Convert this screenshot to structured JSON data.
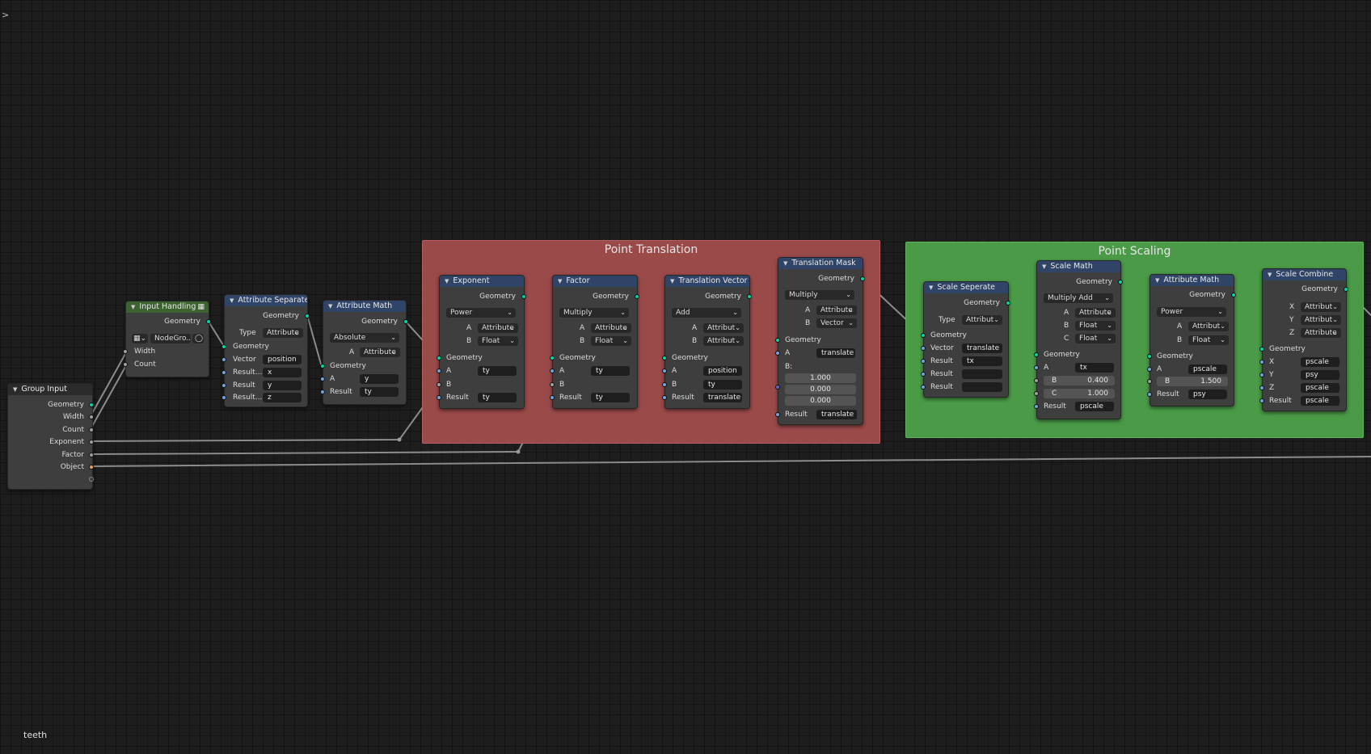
{
  "editor": {
    "tree_name": "teeth",
    "menu_toggle": ">"
  },
  "colors": {
    "frame_translation": "#9b4a4a",
    "frame_scaling": "#4a9a47",
    "header_attribute": "#2f4467",
    "header_group": "#3d6231",
    "socket_geometry": "#00d6a3",
    "socket_string": "#6fa5dc",
    "socket_float": "#a1a1a1",
    "socket_object": "#ed9e5c"
  },
  "frames": {
    "translation": "Point Translation",
    "scaling": "Point Scaling"
  },
  "group_input": {
    "title": "Group Input",
    "outputs": [
      "Geometry",
      "Width",
      "Count",
      "Exponent",
      "Factor",
      "Object"
    ]
  },
  "input_handling": {
    "title": "Input Handling",
    "group_name": "NodeGro...",
    "outputs": [
      "Geometry"
    ],
    "inputs": [
      "Width",
      "Count"
    ]
  },
  "attr_separate": {
    "title": "Attribute Separate ...",
    "out": "Geometry",
    "type_label": "Type",
    "type_value": "Attribute",
    "geometry": "Geometry",
    "vector_label": "Vector",
    "vector_value": "position",
    "r1_label": "Result...",
    "r1_value": "x",
    "r2_label": "Result",
    "r2_value": "y",
    "r3_label": "Result...",
    "r3_value": "z"
  },
  "attr_math1": {
    "title": "Attribute Math",
    "out": "Geometry",
    "op": "Absolute",
    "a_label": "A",
    "a_mode": "Attribute",
    "geometry": "Geometry",
    "a_in": "A",
    "a_value": "y",
    "result_label": "Result",
    "result_value": "ty"
  },
  "exponent": {
    "title": "Exponent",
    "out": "Geometry",
    "op": "Power",
    "a_label": "A",
    "a_mode": "Attribute",
    "b_label": "B",
    "b_mode": "Float",
    "geometry": "Geometry",
    "a_in": "A",
    "a_value": "ty",
    "b_in": "B",
    "result_label": "Result",
    "result_value": "ty"
  },
  "factor": {
    "title": "Factor",
    "out": "Geometry",
    "op": "Multiply",
    "a_label": "A",
    "a_mode": "Attribute",
    "b_label": "B",
    "b_mode": "Float",
    "geometry": "Geometry",
    "a_in": "A",
    "a_value": "ty",
    "b_in": "B",
    "result_label": "Result",
    "result_value": "ty"
  },
  "translation_vector": {
    "title": "Translation Vector",
    "out": "Geometry",
    "op": "Add",
    "a_label": "A",
    "a_mode": "Attribut",
    "b_label": "B",
    "b_mode": "Attribut",
    "geometry": "Geometry",
    "a_in": "A",
    "a_value": "position",
    "b_in": "B",
    "b_value": "ty",
    "result_label": "Result",
    "result_value": "translate"
  },
  "translation_mask": {
    "title": "Translation Mask",
    "out": "Geometry",
    "op": "Multiply",
    "a_label": "A",
    "a_mode": "Attribute",
    "b_label": "B",
    "b_mode": "Vector",
    "geometry": "Geometry",
    "a_in": "A",
    "a_value": "translate",
    "b_in": "B:",
    "b_x": "1.000",
    "b_y": "0.000",
    "b_z": "0.000",
    "result_label": "Result",
    "result_value": "translate"
  },
  "scale_separate": {
    "title": "Scale Seperate",
    "out": "Geometry",
    "type_label": "Type",
    "type_value": "Attribut",
    "geometry": "Geometry",
    "vector_label": "Vector",
    "vector_value": "translate",
    "r1_label": "Result",
    "r1_value": "tx",
    "r2_label": "Result",
    "r2_value": "",
    "r3_label": "Result",
    "r3_value": ""
  },
  "scale_math": {
    "title": "Scale Math",
    "out": "Geometry",
    "op": "Multiply Add",
    "a_label": "A",
    "a_mode": "Attribute",
    "b_label": "B",
    "b_mode": "Float",
    "c_label": "C",
    "c_mode": "Float",
    "geometry": "Geometry",
    "a_in": "A",
    "a_value": "tx",
    "b_in": "B",
    "b_value": "0.400",
    "c_in": "C",
    "c_value": "1.000",
    "result_label": "Result",
    "result_value": "pscale"
  },
  "attr_math2": {
    "title": "Attribute Math",
    "out": "Geometry",
    "op": "Power",
    "a_label": "A",
    "a_mode": "Attribut",
    "b_label": "B",
    "b_mode": "Float",
    "geometry": "Geometry",
    "a_in": "A",
    "a_value": "pscale",
    "b_in": "B",
    "b_value": "1.500",
    "result_label": "Result",
    "result_value": "psy"
  },
  "scale_combine": {
    "title": "Scale Combine",
    "out": "Geometry",
    "x_label": "X",
    "x_mode": "Attribut",
    "y_label": "Y",
    "y_mode": "Attribut",
    "z_label": "Z",
    "z_mode": "Attribute",
    "geometry": "Geometry",
    "x_in": "X",
    "x_value": "pscale",
    "y_in": "Y",
    "y_value": "psy",
    "z_in": "Z",
    "z_value": "pscale",
    "result_label": "Result",
    "result_value": "pscale"
  }
}
